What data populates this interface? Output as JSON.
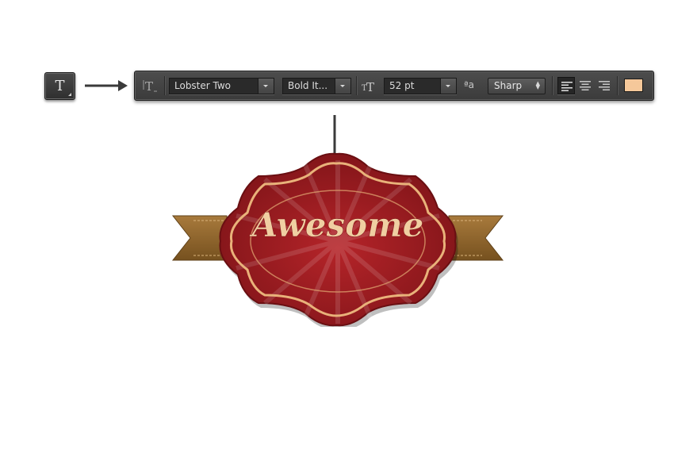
{
  "tool": {
    "icon_glyph": "T",
    "icon_name": "type-tool-icon"
  },
  "options_bar": {
    "orientation_icon_glyph": "T",
    "font_family": "Lobster Two",
    "font_style": "Bold It...",
    "size_icon_glyph": "T",
    "font_size": "52 pt",
    "aa_icon_label": "ªa",
    "anti_alias": "Sharp",
    "alignment_selected": "left",
    "text_color": "#f5c89a"
  },
  "badge": {
    "text": "Awesome",
    "text_color": "#f0cfa2",
    "body_color": "#9e1c20",
    "trim_color": "#e9b27a",
    "ribbon_color": "#8c6430"
  },
  "colors": {
    "bar_bg": "#454545",
    "arrow": "#3a3a3a"
  }
}
